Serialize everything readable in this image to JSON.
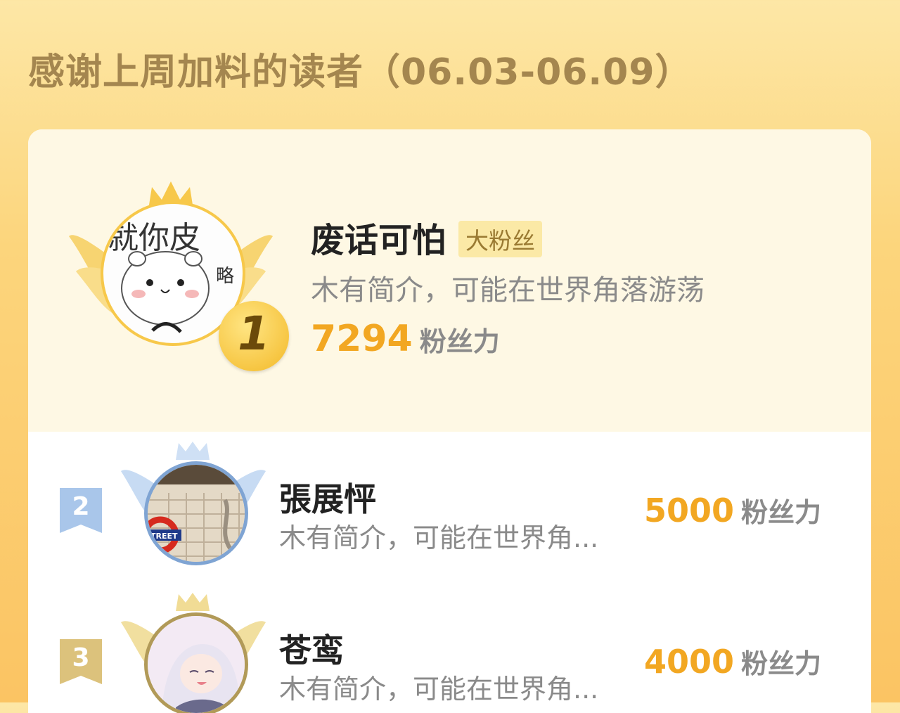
{
  "header": {
    "title": "感谢上周加料的读者（06.03-06.09）"
  },
  "top_fan": {
    "rank": "1",
    "avatar_text": "就你皮",
    "avatar_side_text": "略",
    "name": "废话可怕",
    "badge": "大粉丝",
    "description": "木有简介，可能在世界角落游荡",
    "score": "7294",
    "score_unit": "粉丝力"
  },
  "fans": [
    {
      "rank": "2",
      "name": "張展怦",
      "description": "木有简介，可能在世界角...",
      "score": "5000",
      "score_unit": "粉丝力",
      "avatar_sign": "TREET"
    },
    {
      "rank": "3",
      "name": "苍鸾",
      "description": "木有简介，可能在世界角...",
      "score": "4000",
      "score_unit": "粉丝力"
    }
  ],
  "colors": {
    "accent": "#f2a722",
    "gold": "#f7c84a",
    "silver": "#a9c6ea",
    "bronze": "#dcc27c",
    "title": "#a4864f"
  }
}
